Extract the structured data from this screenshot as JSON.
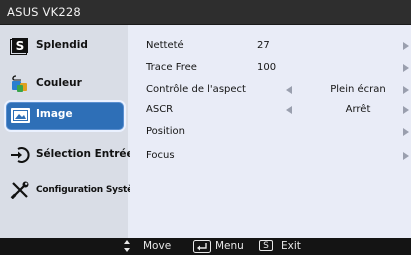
{
  "title": "ASUS VK228",
  "nav": [
    {
      "label": "Splendid",
      "icon": "splendid-s-icon"
    },
    {
      "label": "Couleur",
      "icon": "paint-bucket-icon"
    },
    {
      "label": "Image",
      "icon": "picture-icon"
    },
    {
      "label": "Sélection Entrée",
      "icon": "input-arrow-icon"
    },
    {
      "label": "Configuration Système",
      "icon": "tools-icon"
    }
  ],
  "settings": [
    {
      "name": "Netteté",
      "value": "27"
    },
    {
      "name": "Trace Free",
      "value": "100"
    },
    {
      "name": "Contrôle de l'aspect",
      "option": "Plein écran"
    },
    {
      "name": "ASCR",
      "option": "Arrêt"
    },
    {
      "name": "Position"
    },
    {
      "name": "Focus"
    }
  ],
  "footer": {
    "move_label": "Move",
    "menu_label": "Menu",
    "exit_key": "S",
    "exit_label": "Exit"
  },
  "colors": {
    "active_nav": "#2e6fb7",
    "panel": "#e9ecf7",
    "sidebar": "#d9dde6"
  }
}
